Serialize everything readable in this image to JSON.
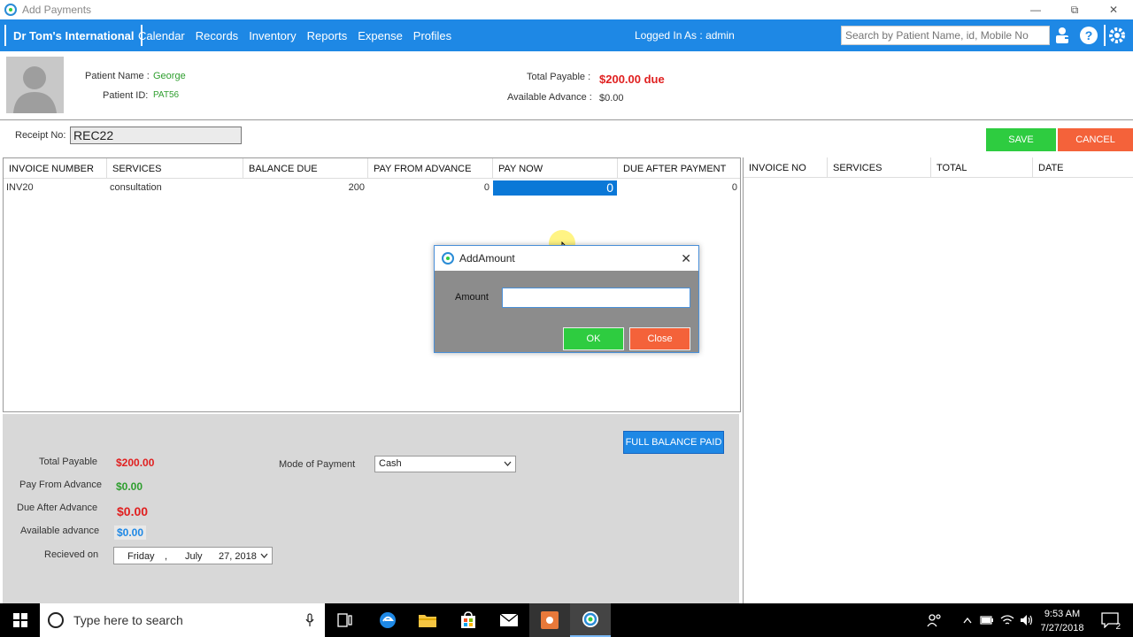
{
  "window": {
    "title": "Add Payments"
  },
  "nav": {
    "brand": "Dr Tom's International",
    "items": [
      "Calendar",
      "Records",
      "Inventory",
      "Reports",
      "Expense",
      "Profiles"
    ],
    "logged_in": "Logged In As : admin",
    "search_placeholder": "Search by Patient Name, id, Mobile No"
  },
  "patient": {
    "name_label": "Patient Name :",
    "name": "George",
    "id_label": "Patient ID:",
    "id": "PAT56",
    "total_payable_label": "Total Payable :",
    "total_payable": "$200.00 due",
    "available_advance_label": "Available Advance :",
    "available_advance": "$0.00"
  },
  "receipt": {
    "label": "Receipt No:",
    "value": "REC22"
  },
  "actions": {
    "save": "SAVE",
    "cancel": "CANCEL"
  },
  "left_table": {
    "headers": [
      "INVOICE NUMBER",
      "SERVICES",
      "BALANCE DUE",
      "PAY FROM ADVANCE",
      "PAY NOW",
      "DUE AFTER PAYMENT"
    ],
    "rows": [
      {
        "invoice": "INV20",
        "service": "consultation",
        "balance_due": "200",
        "pay_from_advance": "0",
        "pay_now": "0",
        "due_after": "0"
      }
    ]
  },
  "right_table": {
    "headers": [
      "INVOICE NO",
      "SERVICES",
      "TOTAL",
      "DATE"
    ]
  },
  "summary": {
    "full_balance_button": "FULL BALANCE PAID",
    "total_payable_label": "Total Payable",
    "total_payable": "$200.00",
    "pay_from_advance_label": "Pay From Advance",
    "pay_from_advance": "$0.00",
    "due_after_advance_label": "Due After Advance",
    "due_after_advance": "$0.00",
    "available_advance_label": "Available advance",
    "available_advance": "$0.00",
    "received_on_label": "Recieved on",
    "date_day": "Friday",
    "date_sep": ",",
    "date_month": "July",
    "date_rest": "27, 2018",
    "mode_label": "Mode of Payment",
    "mode_value": "Cash"
  },
  "dialog": {
    "title": "AddAmount",
    "amount_label": "Amount",
    "amount_value": "",
    "ok": "OK",
    "close": "Close"
  },
  "taskbar": {
    "search_text": "Type here to search",
    "time": "9:53 AM",
    "date": "7/27/2018",
    "notification_count": "2"
  },
  "colors": {
    "nav_blue": "#1e88e5",
    "green": "#2ecc40",
    "red": "#f4623a",
    "due_red": "#e02020"
  }
}
